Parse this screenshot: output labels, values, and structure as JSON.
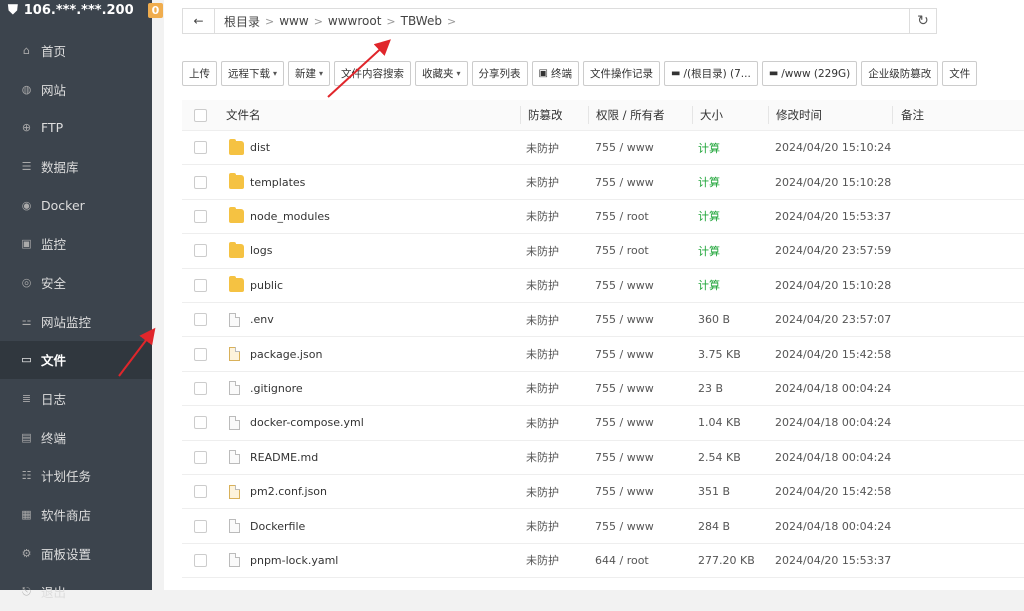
{
  "server": {
    "label": "106.***.***.200",
    "badge": "0"
  },
  "nav": [
    {
      "label": "首页",
      "icon": "home-icon",
      "glyph": "⌂"
    },
    {
      "label": "网站",
      "icon": "globe-icon",
      "glyph": "◍"
    },
    {
      "label": "FTP",
      "icon": "ftp-icon",
      "glyph": "⊕"
    },
    {
      "label": "数据库",
      "icon": "database-icon",
      "glyph": "☰"
    },
    {
      "label": "Docker",
      "icon": "docker-icon",
      "glyph": "◉"
    },
    {
      "label": "监控",
      "icon": "monitor-icon",
      "glyph": "▣"
    },
    {
      "label": "安全",
      "icon": "shield-icon",
      "glyph": "◎"
    },
    {
      "label": "网站监控",
      "icon": "chart-icon",
      "glyph": "⚍"
    },
    {
      "label": "文件",
      "icon": "folder-icon",
      "glyph": "▭",
      "active": true
    },
    {
      "label": "日志",
      "icon": "log-icon",
      "glyph": "≣"
    },
    {
      "label": "终端",
      "icon": "terminal-icon",
      "glyph": "▤"
    },
    {
      "label": "计划任务",
      "icon": "task-icon",
      "glyph": "☷"
    },
    {
      "label": "软件商店",
      "icon": "store-icon",
      "glyph": "▦"
    },
    {
      "label": "面板设置",
      "icon": "gear-icon",
      "glyph": "⚙"
    },
    {
      "label": "退出",
      "icon": "logout-icon",
      "glyph": "⎋"
    }
  ],
  "path": {
    "back_glyph": "←",
    "crumbs": [
      "根目录",
      "www",
      "wwwroot",
      "TBWeb"
    ],
    "separator": ">",
    "refresh_glyph": "↻"
  },
  "toolbar": [
    {
      "label": "上传",
      "dropdown": false
    },
    {
      "label": "远程下载",
      "dropdown": true
    },
    {
      "label": "新建",
      "dropdown": true
    },
    {
      "label": "文件内容搜索",
      "dropdown": false
    },
    {
      "label": "收藏夹",
      "dropdown": true
    },
    {
      "label": "分享列表",
      "dropdown": false
    },
    {
      "label": "终端",
      "dropdown": false,
      "icon": "terminal-icon"
    },
    {
      "label": "文件操作记录",
      "dropdown": false
    },
    {
      "label": "/(根目录) (7...",
      "dropdown": false,
      "icon": "disk-icon"
    },
    {
      "label": "/www (229G)",
      "dropdown": false,
      "icon": "disk-icon"
    },
    {
      "label": "企业级防篡改",
      "dropdown": false
    },
    {
      "label": "文件",
      "dropdown": false
    }
  ],
  "columns": {
    "name": "文件名",
    "protect": "防篡改",
    "perm": "权限 / 所有者",
    "size": "大小",
    "mtime": "修改时间",
    "note": "备注"
  },
  "rows": [
    {
      "name": "dist",
      "type": "folder",
      "protect": "未防护",
      "perm": "755 / www",
      "size": "计算",
      "mtime": "2024/04/20 15:10:24"
    },
    {
      "name": "templates",
      "type": "folder",
      "protect": "未防护",
      "perm": "755 / www",
      "size": "计算",
      "mtime": "2024/04/20 15:10:28"
    },
    {
      "name": "node_modules",
      "type": "folder",
      "protect": "未防护",
      "perm": "755 / root",
      "size": "计算",
      "mtime": "2024/04/20 15:53:37"
    },
    {
      "name": "logs",
      "type": "folder",
      "protect": "未防护",
      "perm": "755 / root",
      "size": "计算",
      "mtime": "2024/04/20 23:57:59"
    },
    {
      "name": "public",
      "type": "folder",
      "protect": "未防护",
      "perm": "755 / www",
      "size": "计算",
      "mtime": "2024/04/20 15:10:28"
    },
    {
      "name": ".env",
      "type": "file",
      "protect": "未防护",
      "perm": "755 / www",
      "size": "360 B",
      "mtime": "2024/04/20 23:57:07"
    },
    {
      "name": "package.json",
      "type": "json",
      "protect": "未防护",
      "perm": "755 / www",
      "size": "3.75 KB",
      "mtime": "2024/04/20 15:42:58"
    },
    {
      "name": ".gitignore",
      "type": "file",
      "protect": "未防护",
      "perm": "755 / www",
      "size": "23 B",
      "mtime": "2024/04/18 00:04:24"
    },
    {
      "name": "docker-compose.yml",
      "type": "file",
      "protect": "未防护",
      "perm": "755 / www",
      "size": "1.04 KB",
      "mtime": "2024/04/18 00:04:24"
    },
    {
      "name": "README.md",
      "type": "file",
      "protect": "未防护",
      "perm": "755 / www",
      "size": "2.54 KB",
      "mtime": "2024/04/18 00:04:24"
    },
    {
      "name": "pm2.conf.json",
      "type": "json",
      "protect": "未防护",
      "perm": "755 / www",
      "size": "351 B",
      "mtime": "2024/04/20 15:42:58"
    },
    {
      "name": "Dockerfile",
      "type": "file",
      "protect": "未防护",
      "perm": "755 / www",
      "size": "284 B",
      "mtime": "2024/04/18 00:04:24"
    },
    {
      "name": "pnpm-lock.yaml",
      "type": "file",
      "protect": "未防护",
      "perm": "644 / root",
      "size": "277.20 KB",
      "mtime": "2024/04/20 15:53:37"
    }
  ],
  "colors": {
    "sidebar": "#3c444d",
    "accent": "#20a53a",
    "folder": "#f5c242",
    "badge": "#f0ad4e",
    "arrow": "#e0262b"
  }
}
